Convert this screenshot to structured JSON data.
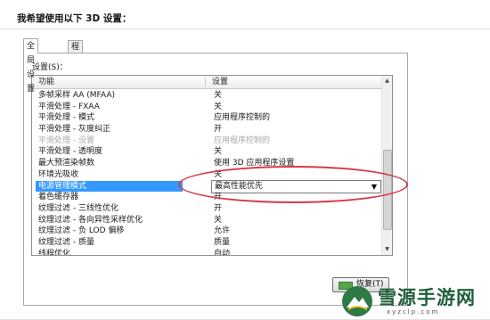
{
  "heading": "我希望使用以下 3D 设置：",
  "tabs": [
    {
      "label": "全局设置",
      "active": true
    },
    {
      "label": "程序设置",
      "active": false
    }
  ],
  "settings_caption": "设置(S)：",
  "columns": {
    "feature": "功能",
    "setting": "设置"
  },
  "rows": [
    {
      "feature": "多帧采样 AA (MFAA)",
      "value": "关",
      "state": "normal"
    },
    {
      "feature": "平滑处理 - FXAA",
      "value": "关",
      "state": "normal"
    },
    {
      "feature": "平滑处理 - 模式",
      "value": "应用程序控制的",
      "state": "normal"
    },
    {
      "feature": "平滑处理 - 灰度纠正",
      "value": "开",
      "state": "normal"
    },
    {
      "feature": "平滑处理 - 设置",
      "value": "应用程序控制的",
      "state": "disabled"
    },
    {
      "feature": "平滑处理 - 透明度",
      "value": "关",
      "state": "normal"
    },
    {
      "feature": "最大预渲染帧数",
      "value": "使用 3D 应用程序设置",
      "state": "normal"
    },
    {
      "feature": "环境光吸收",
      "value": "关",
      "state": "normal"
    },
    {
      "feature": "电源管理模式",
      "value": "最高性能优先",
      "state": "selected"
    },
    {
      "feature": "着色缓存器",
      "value": "开",
      "state": "normal"
    },
    {
      "feature": "纹理过滤 - 三线性优化",
      "value": "开",
      "state": "normal"
    },
    {
      "feature": "纹理过滤 - 各向异性采样优化",
      "value": "关",
      "state": "normal"
    },
    {
      "feature": "纹理过滤 - 负 LOD 偏移",
      "value": "允许",
      "state": "normal"
    },
    {
      "feature": "纹理过滤 - 质量",
      "value": "质量",
      "state": "normal"
    },
    {
      "feature": "线程优化",
      "value": "自动",
      "state": "normal"
    }
  ],
  "restore_button": "恢复(T)",
  "watermark": {
    "name": "雪源手游网",
    "url": "xyzclp.com"
  },
  "colors": {
    "selection": "#3399ff",
    "highlight_ring": "#d63a4a",
    "watermark_green": "#1f5f3a"
  }
}
